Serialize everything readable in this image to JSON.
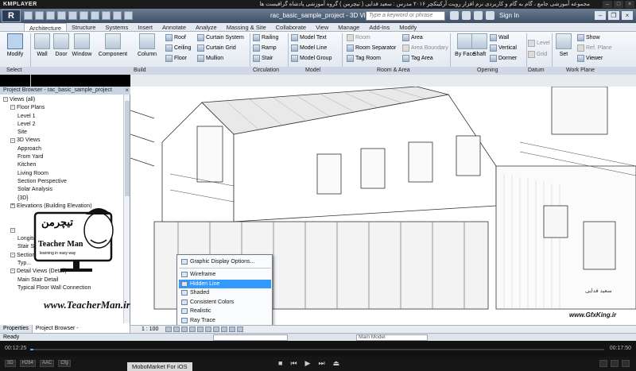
{
  "player": {
    "name": "KMPLAYER",
    "caption": "مجموعه آموزشی جامع ، گام به گام و کاربردی نرم افزار رویت آرکیتکچر ۲۰۱۶ مدرس : سعید فدایی ( تیچرمن ) گروه آموزشی پادشاه گرافیست ها",
    "time_elapsed": "00:12:25",
    "time_total": "00:17:50",
    "progress": 0.005,
    "toolbar_left": [
      "3D",
      "H264",
      "AAC",
      "Cfg"
    ],
    "controls": {
      "stop": "■",
      "prev": "⏮",
      "play": "▶",
      "next": "⏭",
      "eject": "⏏"
    },
    "ad_label": "MoboMarket For iOS"
  },
  "revit": {
    "app_letter": "R",
    "document_title": "rac_basic_sample_project - 3D View: {3D}",
    "search_placeholder": "Type a keyword or phrase",
    "sign_in": "Sign In",
    "tabs": [
      "Architecture",
      "Structure",
      "Systems",
      "Insert",
      "Annotate",
      "Analyze",
      "Massing & Site",
      "Collaborate",
      "View",
      "Manage",
      "Add-Ins",
      "Modify"
    ],
    "active_tab": "Architecture",
    "big_buttons": [
      "Modify",
      "Wall",
      "Door",
      "Window",
      "Component",
      "Column",
      "By Face",
      "Shaft",
      "Set"
    ],
    "build_small": [
      "Roof",
      "Ceiling",
      "Floor",
      "Curtain System",
      "Curtain Grid",
      "Mullion"
    ],
    "circulation_small": [
      "Railing",
      "Ramp",
      "Stair"
    ],
    "model_small": [
      "Model Text",
      "Model Line",
      "Model Group"
    ],
    "room_small": [
      "Room",
      "Room Separator",
      "Tag Room",
      "Area",
      "Area Boundary",
      "Tag Area"
    ],
    "opening_small": [
      "Wall",
      "Vertical",
      "Dormer"
    ],
    "datum_small": [
      "Level",
      "Grid"
    ],
    "workplane_small": [
      "Show",
      "Ref. Plane",
      "Viewer"
    ],
    "panel_labels": [
      "Select",
      "Build",
      "Circulation",
      "Model",
      "Room & Area",
      "Opening",
      "Datum",
      "Work Plane"
    ],
    "browser_title": "Project Browser - rac_basic_sample_project",
    "tree": [
      {
        "label": "Views (all)",
        "level": 0,
        "toggle": "-"
      },
      {
        "label": "Floor Plans",
        "level": 1,
        "toggle": "-"
      },
      {
        "label": "Level 1",
        "level": 2,
        "toggle": ""
      },
      {
        "label": "Level 2",
        "level": 2,
        "toggle": ""
      },
      {
        "label": "Site",
        "level": 2,
        "toggle": ""
      },
      {
        "label": "3D Views",
        "level": 1,
        "toggle": "-"
      },
      {
        "label": "Approach",
        "level": 2,
        "toggle": ""
      },
      {
        "label": "From Yard",
        "level": 2,
        "toggle": ""
      },
      {
        "label": "Kitchen",
        "level": 2,
        "toggle": ""
      },
      {
        "label": "Living Room",
        "level": 2,
        "toggle": ""
      },
      {
        "label": "Section Perspective",
        "level": 2,
        "toggle": ""
      },
      {
        "label": "Solar Analysis",
        "level": 2,
        "toggle": ""
      },
      {
        "label": "{3D}",
        "level": 2,
        "toggle": ""
      },
      {
        "label": "Elevations (Building Elevation)",
        "level": 1,
        "toggle": "+"
      },
      {
        "label": "",
        "level": 2,
        "toggle": ""
      },
      {
        "label": "",
        "level": 2,
        "toggle": ""
      },
      {
        "label": "",
        "level": 1,
        "toggle": "-"
      },
      {
        "label": "Longitudinal",
        "level": 2,
        "toggle": ""
      },
      {
        "label": "Stair Section",
        "level": 2,
        "toggle": ""
      },
      {
        "label": "Sections (Wall Section)",
        "level": 1,
        "toggle": "-"
      },
      {
        "label": "Typ...",
        "level": 2,
        "toggle": ""
      },
      {
        "label": "Detail Views (Detail)",
        "level": 1,
        "toggle": "-"
      },
      {
        "label": "Main Stair Detail",
        "level": 2,
        "toggle": ""
      },
      {
        "label": "Typical Floor Wall Connection",
        "level": 2,
        "toggle": ""
      }
    ],
    "bottom_tabs": [
      "Properties",
      "Project Browser - rac_basic_sample_..."
    ],
    "scale": "1 : 100",
    "status": "Ready",
    "main_model": "Main Model",
    "context_menu": [
      {
        "label": "Graphic Display Options...",
        "highlight": false
      },
      {
        "label": "Wireframe",
        "highlight": false
      },
      {
        "label": "Hidden Line",
        "highlight": true
      },
      {
        "label": "Shaded",
        "highlight": false
      },
      {
        "label": "Consistent Colors",
        "highlight": false
      },
      {
        "label": "Realistic",
        "highlight": false
      },
      {
        "label": "Ray Trace",
        "highlight": false
      }
    ]
  },
  "watermark": {
    "teacher_fa": "تیچرمن",
    "teacher_en": "Teacher Man",
    "teacher_sub": "learning in easy way",
    "teacher_site": "www.TeacherMan.ir",
    "gfx_name": "سعید فدایی",
    "gfx_site": "www.GfxKing.ir"
  },
  "colors": {
    "highlight": "#3399ff",
    "ribbon_bg": "#e4e9f0",
    "player_bg": "#121212"
  }
}
